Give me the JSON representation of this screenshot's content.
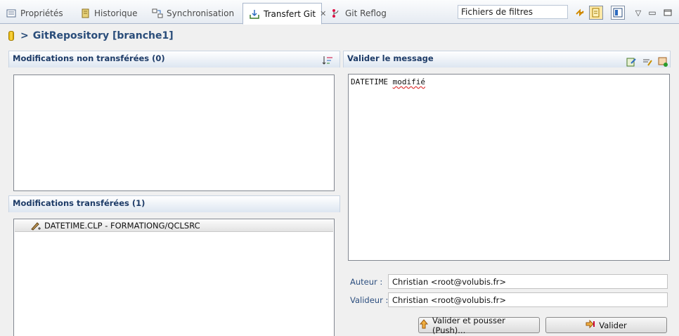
{
  "tabs": [
    {
      "label": "Propriétés",
      "icon": "properties-icon"
    },
    {
      "label": "Historique",
      "icon": "history-icon"
    },
    {
      "label": "Synchronisation",
      "icon": "sync-icon"
    },
    {
      "label": "Transfert Git",
      "icon": "git-staging-icon",
      "active": true
    },
    {
      "label": "Git Reflog",
      "icon": "git-reflog-icon"
    }
  ],
  "filter": {
    "value": "Fichiers de filtres"
  },
  "repo": {
    "arrow": ">",
    "title": "GitRepository [branche1]"
  },
  "unstaged": {
    "title": "Modifications non transférées (0)",
    "items": []
  },
  "staged": {
    "title": "Modifications transférées (1)",
    "items": [
      {
        "label": "DATETIME.CLP - FORMATIONG/QCLSRC",
        "icon": "modified-file-icon"
      }
    ]
  },
  "commit": {
    "title": "Valider le message",
    "message_word1": "DATETIME",
    "message_word2": "modifié",
    "author_label": "Auteur :",
    "author_value": "Christian <root@volubis.fr>",
    "committer_label": "Valideur :",
    "committer_value": "Christian <root@volubis.fr>",
    "commit_push_label": "Valider et pousser (Push)...",
    "commit_label": "Valider"
  },
  "colors": {
    "section_title": "#1d3b67",
    "accent": "#2a4d7a"
  }
}
